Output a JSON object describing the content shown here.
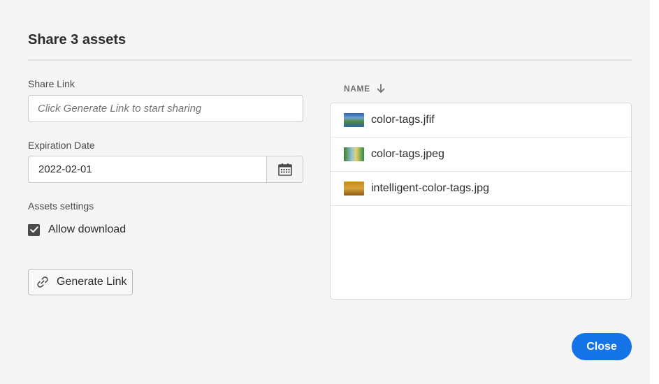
{
  "dialog": {
    "title": "Share 3 assets",
    "share_link": {
      "label": "Share Link",
      "value": "",
      "placeholder": "Click Generate Link to start sharing"
    },
    "expiration": {
      "label": "Expiration Date",
      "value": "2022-02-01",
      "picker_icon": "calendar-icon"
    },
    "assets_settings": {
      "label": "Assets settings",
      "allow_download": {
        "label": "Allow download",
        "checked": true
      }
    },
    "generate_button": {
      "label": "Generate Link",
      "icon": "link-icon"
    },
    "file_table": {
      "column": "NAME",
      "sort_icon": "arrow-down-icon",
      "files": [
        {
          "name": "color-tags.jfif"
        },
        {
          "name": "color-tags.jpeg"
        },
        {
          "name": "intelligent-color-tags.jpg"
        }
      ]
    },
    "close_button": {
      "label": "Close"
    }
  },
  "colors": {
    "accent": "#1473e6",
    "dialog_background": "#f5f5f5",
    "checkbox": "#4b4b4b"
  }
}
